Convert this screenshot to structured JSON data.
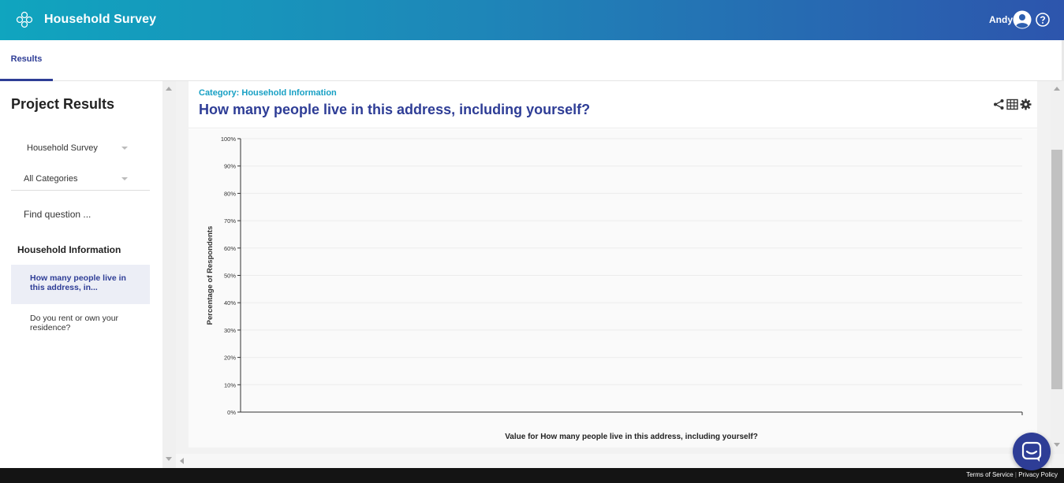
{
  "header": {
    "app_title": "Household Survey",
    "user_name": "Andy",
    "logo_icon": "flower-logo-icon",
    "user_icon": "user-avatar-icon",
    "help_icon": "help-circle-icon"
  },
  "tabs": [
    {
      "label": "Results",
      "active": true
    }
  ],
  "sidebar": {
    "title": "Project Results",
    "survey_select": "Household Survey",
    "category_select": "All Categories",
    "find_placeholder": "Find question ...",
    "category_heading": "Household Information",
    "questions": [
      {
        "label": "How many people live in this address, in...",
        "active": true
      },
      {
        "label": "Do you rent or own your residence?",
        "active": false
      }
    ]
  },
  "card": {
    "category": "Category: Household Information",
    "question": "How many people live in this address, including yourself?",
    "tools": [
      "share-icon",
      "table-grid-icon",
      "gear-icon"
    ]
  },
  "chart_data": {
    "type": "bar",
    "categories": [],
    "values": [],
    "ylabel": "Percentage of Respondents",
    "xlabel": "Value for How many people live in this address, including yourself?",
    "ylim": [
      0,
      100
    ],
    "yticks": [
      "0%",
      "10%",
      "20%",
      "30%",
      "40%",
      "50%",
      "60%",
      "70%",
      "80%",
      "90%",
      "100%"
    ],
    "grid": true
  },
  "footer": {
    "terms": "Terms of Service",
    "separator": "|",
    "privacy": "Privacy Policy"
  },
  "colors": {
    "brand": "#2e3d96",
    "accent": "#17a0c4"
  }
}
